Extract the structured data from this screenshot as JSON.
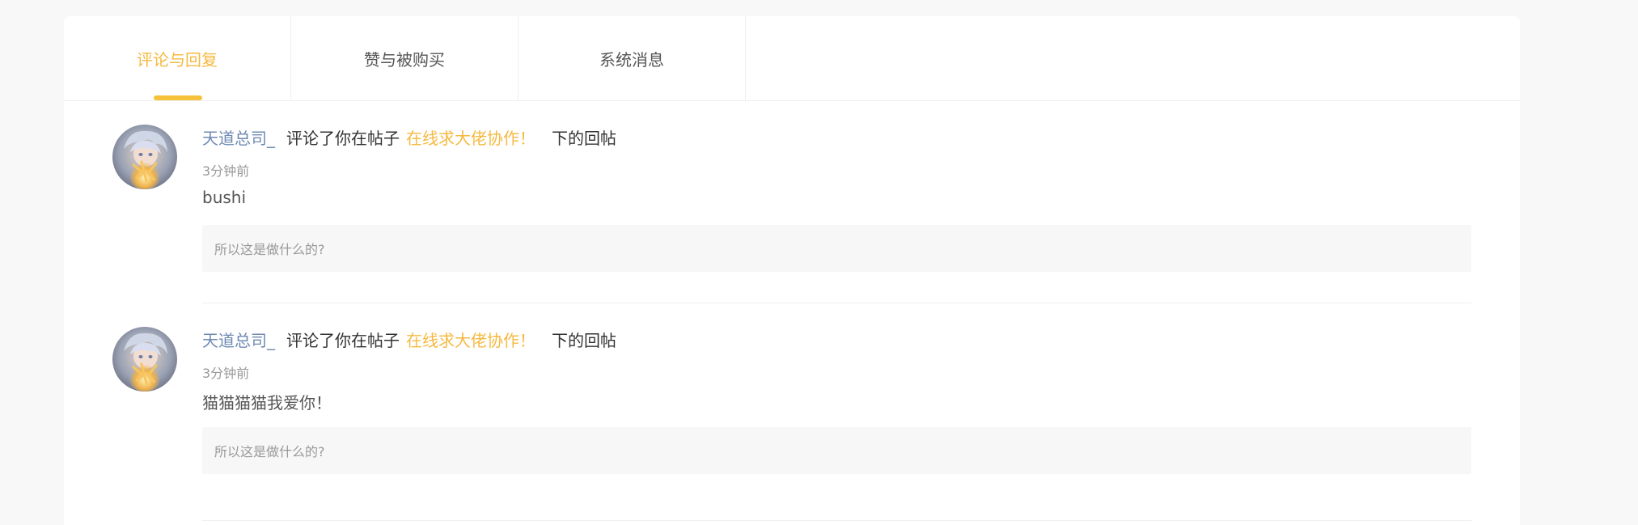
{
  "tabs": [
    {
      "label": "评论与回复",
      "active": true
    },
    {
      "label": "赞与被购买",
      "active": false
    },
    {
      "label": "系统消息",
      "active": false
    }
  ],
  "messages": [
    {
      "username": "天道总司_",
      "action_text": "评论了你在帖子",
      "post_title": "在线求大佬协作！",
      "suffix_text": "下的回帖",
      "time": "3分钟前",
      "content": "bushi",
      "quoted_reply": "所以这是做什么的?"
    },
    {
      "username": "天道总司_",
      "action_text": "评论了你在帖子",
      "post_title": "在线求大佬协作！",
      "suffix_text": "下的回帖",
      "time": "3分钟前",
      "content": "猫猫猫猫我爱你！",
      "quoted_reply": "所以这是做什么的?"
    }
  ],
  "colors": {
    "accent": "#f6b940",
    "username": "#6f8ab3",
    "text": "#333333",
    "muted": "#999999",
    "page_bg": "#f8f8f8"
  },
  "icons": {
    "avatar": "anime-character-avatar"
  }
}
